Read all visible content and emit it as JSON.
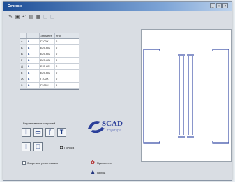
{
  "window": {
    "title": "Сечение",
    "controls": [
      "_",
      "□",
      "×"
    ]
  },
  "toolbar": {
    "icons": [
      "open-icon",
      "save-icon",
      "undo-icon",
      "table-icon",
      "grid-icon",
      "disabled-icon",
      "disabled-icon"
    ]
  },
  "table": {
    "headers": [
      "",
      "",
      "Элемент",
      "Угол",
      ""
    ],
    "rows": [
      [
        "А",
        "L",
        "Г100Х",
        "0",
        ""
      ],
      [
        "Б",
        "L",
        "Б25.6Б",
        "0",
        ""
      ],
      [
        "В",
        "L",
        "Б25.6Б",
        "0",
        ""
      ],
      [
        "Г",
        "L",
        "Б25.6Б",
        "0",
        ""
      ],
      [
        "Д",
        "L",
        "Б25.6Б",
        "0",
        ""
      ],
      [
        "Е",
        "L",
        "Б25.6Б",
        "0",
        ""
      ],
      [
        "Ж",
        "L",
        "Г100Х",
        "0",
        ""
      ],
      [
        "З",
        "L",
        "Г100Х",
        "0",
        ""
      ]
    ]
  },
  "shapes_group": {
    "label": "Выравнивание стержней"
  },
  "profile_button": {
    "label": "Полоса"
  },
  "checkbox": {
    "label": "Запретить регистрацию",
    "checked": false
  },
  "brand": {
    "name": "SCAD",
    "subtitle": "Структура"
  },
  "actions": {
    "ok_label": "Применить",
    "cancel_label": "Выход"
  },
  "colors": {
    "titlebar": "#1e4f97",
    "profile_line": "#3b4fa8",
    "logo_blue": "#2b3f9a"
  }
}
